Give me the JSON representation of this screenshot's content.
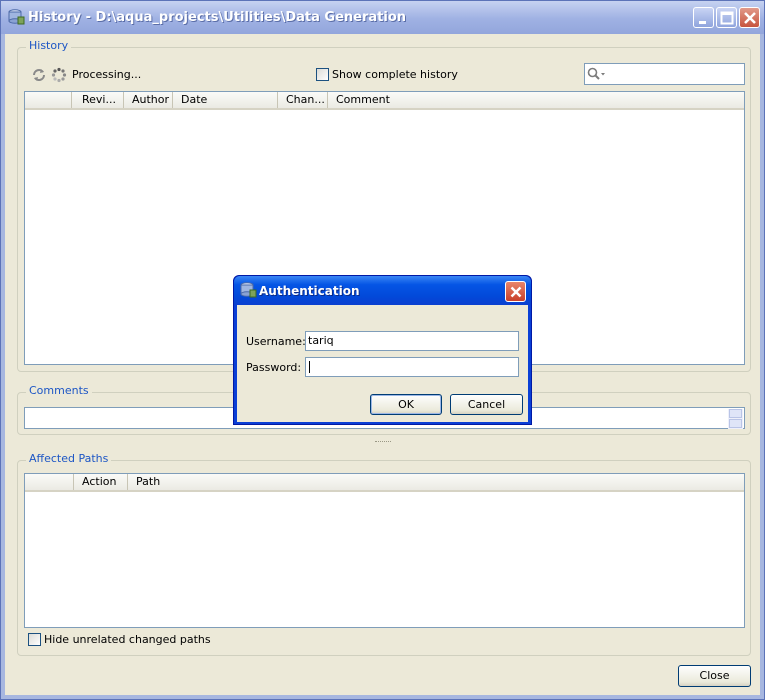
{
  "window": {
    "title": "History - D:\\aqua_projects\\Utilities\\Data Generation"
  },
  "history": {
    "group_label": "History",
    "status_text": "Processing...",
    "show_complete_label": "Show complete history",
    "show_complete_checked": false,
    "search_placeholder": "",
    "columns": [
      "",
      "Revi...",
      "Author",
      "Date",
      "Chan...",
      "Comment"
    ],
    "rows": []
  },
  "comments": {
    "group_label": "Comments",
    "value": ""
  },
  "affected": {
    "group_label": "Affected Paths",
    "columns": [
      "",
      "Action",
      "Path"
    ],
    "rows": [],
    "hide_unrelated_label": "Hide unrelated changed paths",
    "hide_unrelated_checked": false
  },
  "footer": {
    "close_label": "Close"
  },
  "auth_dialog": {
    "title": "Authentication",
    "username_label": "Username:",
    "username_value": "tariq",
    "password_label": "Password:",
    "password_value": "",
    "ok_label": "OK",
    "cancel_label": "Cancel"
  },
  "icons": {
    "app": "database-icon",
    "refresh": "refresh-icon",
    "processing": "spinner-icon",
    "search": "search-icon"
  }
}
